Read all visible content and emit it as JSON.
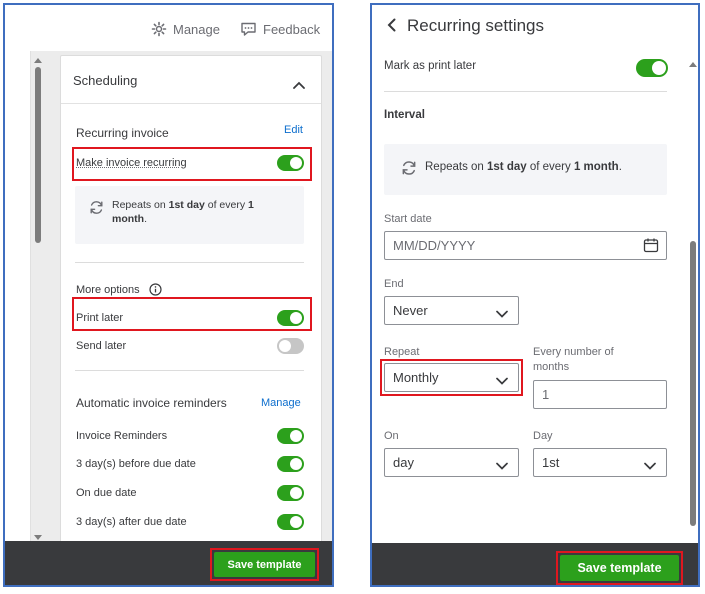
{
  "left": {
    "top_bar": {
      "manage_label": "Manage",
      "feedback_label": "Feedback"
    },
    "section_title": "Scheduling",
    "recurring_invoice": {
      "heading": "Recurring invoice",
      "edit_link": "Edit",
      "toggle_label": "Make invoice recurring",
      "toggle_on": true
    },
    "repeat_info": {
      "prefix": "Repeats on ",
      "day": "1st day",
      "middle": " of every ",
      "count": "1",
      "unit": "month",
      "suffix": "."
    },
    "more_options": {
      "heading": "More options",
      "print_later": "Print later",
      "print_later_on": true,
      "send_later": "Send later",
      "send_later_on": false
    },
    "reminders": {
      "heading": "Automatic invoice reminders",
      "manage_link": "Manage",
      "items": [
        {
          "label": "Invoice Reminders",
          "on": true
        },
        {
          "label": "3 day(s) before due date",
          "on": true
        },
        {
          "label": "On due date",
          "on": true
        },
        {
          "label": "3 day(s) after due date",
          "on": true
        }
      ]
    },
    "save_button": "Save template"
  },
  "right": {
    "title": "Recurring settings",
    "mark_print_later": "Mark as print later",
    "mark_print_later_on": true,
    "interval_heading": "Interval",
    "repeat_info": {
      "prefix": "Repeats on ",
      "day": "1st day",
      "middle": " of every ",
      "count": "1 month",
      "suffix": "."
    },
    "start_date": {
      "label": "Start date",
      "placeholder": "MM/DD/YYYY"
    },
    "end": {
      "label": "End",
      "value": "Never"
    },
    "repeat": {
      "label": "Repeat",
      "value": "Monthly"
    },
    "every_number": {
      "label_line1": "Every number of",
      "label_line2": "months",
      "value": "1"
    },
    "on": {
      "label": "On",
      "value": "day"
    },
    "day": {
      "label": "Day",
      "value": "1st"
    },
    "save_button": "Save template"
  },
  "colors": {
    "accent_green": "#2ca01c",
    "highlight_red": "#e0171f",
    "link_blue": "#0d6ecd",
    "footer_dark": "#393a3d",
    "panel_border": "#3f6ebf"
  }
}
